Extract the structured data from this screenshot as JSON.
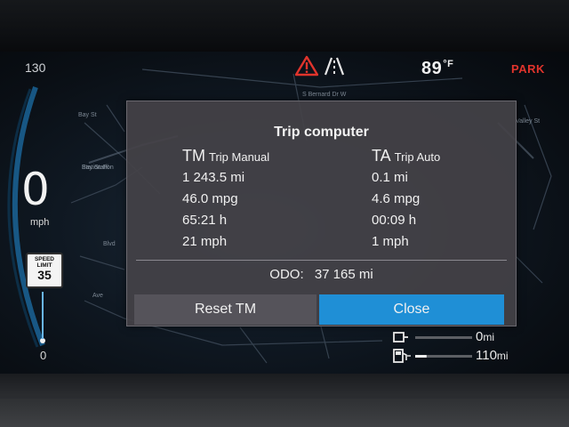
{
  "cluster": {
    "speed_scale_top": "130",
    "speed_scale_bottom": "0",
    "speed": "0",
    "speed_unit": "mph",
    "speed_limit_label": "SPEED LIMIT",
    "speed_limit_value": "35",
    "temperature_value": "89",
    "temperature_unit": "°F",
    "gear_indicator": "PARK",
    "icons": [
      "warning-triangle-icon",
      "lane-departure-icon",
      "charging-plug-icon",
      "fuel-pump-icon"
    ],
    "colors": {
      "park": "#e0342c",
      "close_button": "#1f8fd6",
      "warning": "#e0342c"
    }
  },
  "map": {
    "street_labels": [
      "Bay Station",
      "Station Pl",
      "Blvd",
      "Ave",
      "S Bernard Dr W",
      "Valley St"
    ]
  },
  "dialog": {
    "title": "Trip computer",
    "left": {
      "abbr": "TM",
      "name": "Trip Manual",
      "distance": "1 243.5 mi",
      "economy": "46.0 mpg",
      "time": "65:21 h",
      "avg_speed": "21 mph"
    },
    "right": {
      "abbr": "TA",
      "name": "Trip Auto",
      "distance": "0.1 mi",
      "economy": "4.6 mpg",
      "time": "00:09 h",
      "avg_speed": "1 mph"
    },
    "odo_label": "ODO:",
    "odo_value": "37 165 mi",
    "reset_label": "Reset TM",
    "close_label": "Close"
  },
  "range": {
    "electric_value": "0",
    "electric_unit": "mi",
    "fuel_value": "110",
    "fuel_unit": "mi",
    "electric_level": 0.0,
    "fuel_level": 0.2
  }
}
